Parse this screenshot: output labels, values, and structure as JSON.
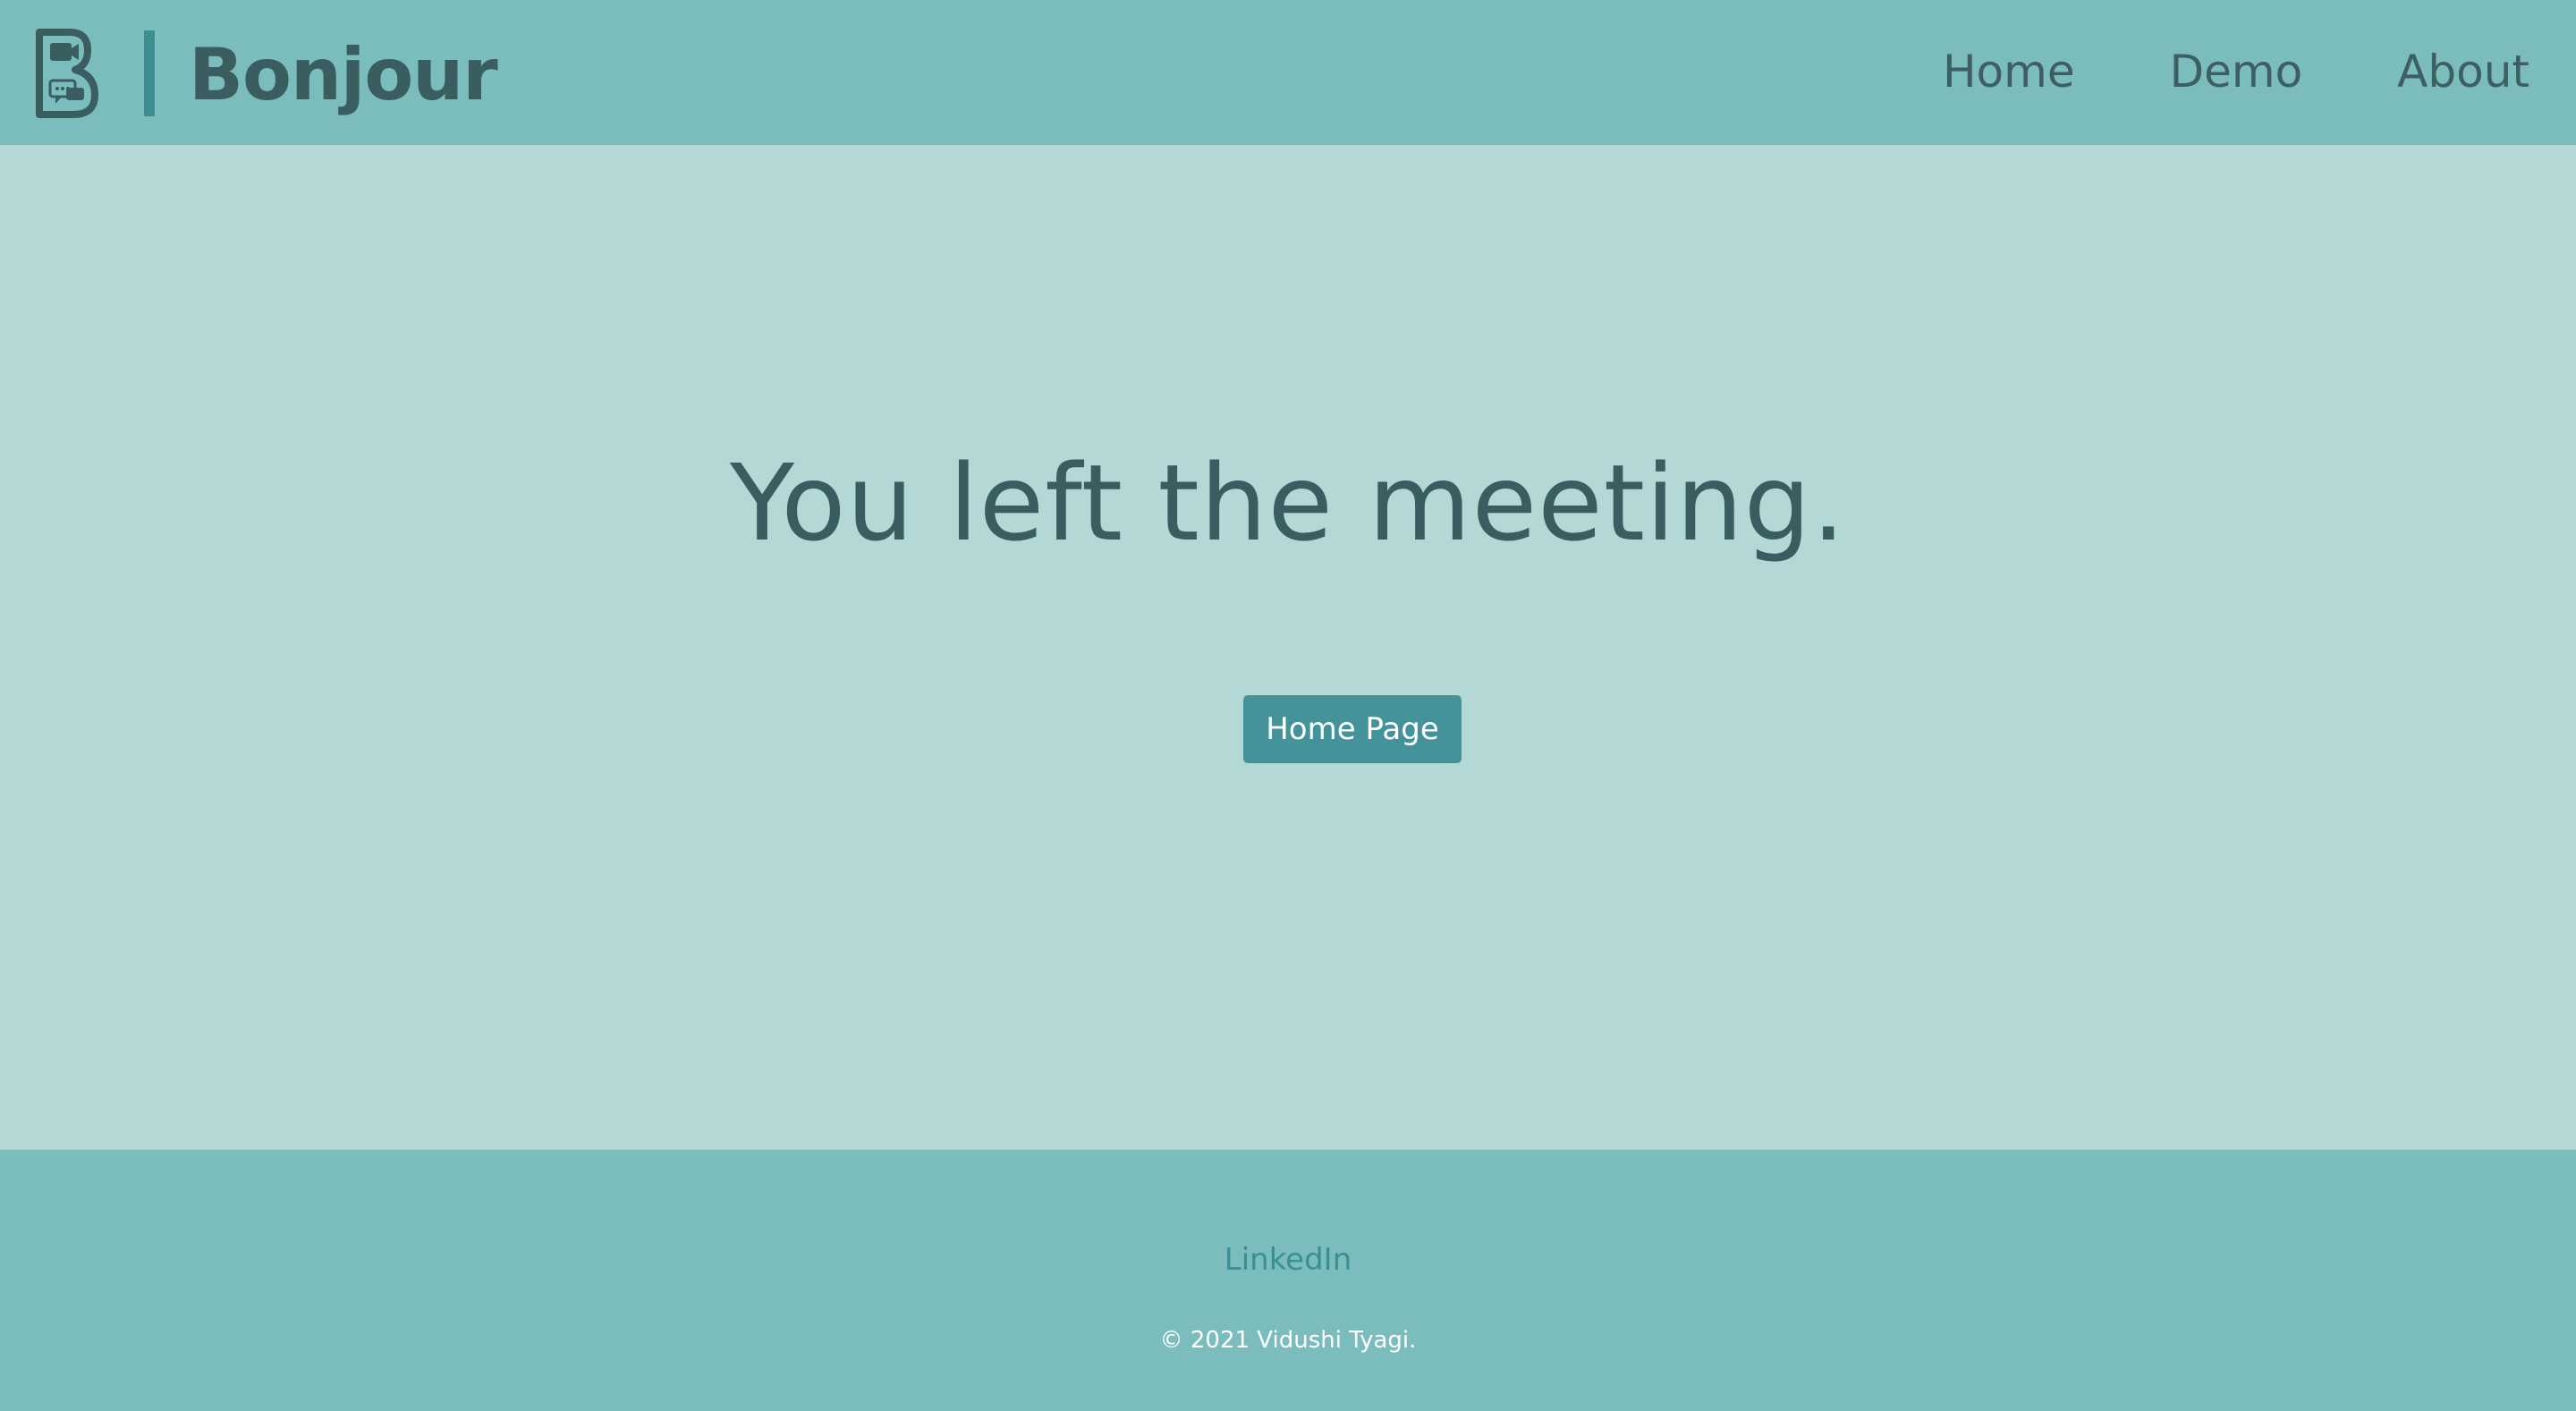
{
  "navbar": {
    "brand_name": "Bonjour",
    "logo_icon": "b-video-chat-logo-icon",
    "links": [
      {
        "label": "Home"
      },
      {
        "label": "Demo"
      },
      {
        "label": "About"
      }
    ]
  },
  "main": {
    "headline": "You left the meeting.",
    "button_label": "Home Page"
  },
  "footer": {
    "link_label": "LinkedIn",
    "copyright": "© 2021 Vidushi Tyagi."
  },
  "colors": {
    "navbar_bg": "#7bbcbd",
    "page_bg": "#b3d8d5",
    "accent": "#44939a",
    "text_dark": "#395d60",
    "footer_link": "#3b8f93",
    "footer_text": "#ffffff"
  }
}
